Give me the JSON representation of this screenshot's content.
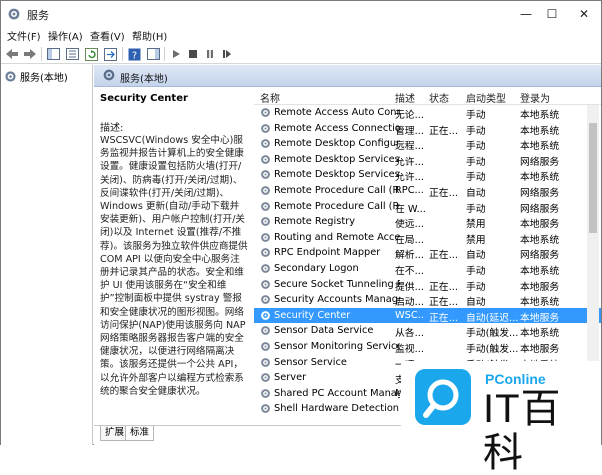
{
  "window": {
    "title": "服务",
    "minimize": "—",
    "maximize": "☐",
    "close": "✕"
  },
  "menu": [
    "文件(F)",
    "操作(A)",
    "查看(V)",
    "帮助(H)"
  ],
  "tree": {
    "root_label": "服务(本地)"
  },
  "content_header": "服务(本地)",
  "description": {
    "service_title": "Security Center",
    "label": "描述:",
    "text": "WSCSVC(Windows 安全中心)服务监视并报告计算机上的安全健康设置。健康设置包括防火墙(打开/关闭)、防病毒(打开/关闭/过期)、反间谍软件(打开/关闭/过期)、Windows 更新(自动/手动下载并安装更新)、用户帐户控制(打开/关闭)以及 Internet 设置(推荐/不推荐)。该服务为独立软件供应商提供 COM API 以便向安全中心服务注册并记录其产品的状态。安全和维护 UI 使用该服务在“安全和维护”控制面板中提供 systray 警报和安全健康状况的图形视图。网络访问保护(NAP)使用该服务向 NAP 网络策略服务器报告客户端的安全健康状况，以便进行网络隔离决策。该服务还提供一个公共 API，以允许外部客户以编程方式检索系统的聚合安全健康状况。"
  },
  "columns": {
    "name": "名称",
    "desc": "描述",
    "status": "状态",
    "startup": "启动类型",
    "logon": "登录为"
  },
  "services": [
    {
      "name": "Remote Access Auto Conn...",
      "desc": "无论...",
      "status": "",
      "startup": "手动",
      "logon": "本地系统"
    },
    {
      "name": "Remote Access Connectio...",
      "desc": "管理...",
      "status": "正在...",
      "startup": "手动",
      "logon": "本地系统"
    },
    {
      "name": "Remote Desktop Configur...",
      "desc": "远程...",
      "status": "",
      "startup": "手动",
      "logon": "本地系统"
    },
    {
      "name": "Remote Desktop Services",
      "desc": "允许...",
      "status": "",
      "startup": "手动",
      "logon": "网络服务"
    },
    {
      "name": "Remote Desktop Services ...",
      "desc": "允许...",
      "status": "",
      "startup": "手动",
      "logon": "本地系统"
    },
    {
      "name": "Remote Procedure Call (R...",
      "desc": "RPC...",
      "status": "正在...",
      "startup": "自动",
      "logon": "网络服务"
    },
    {
      "name": "Remote Procedure Call (R...",
      "desc": "在 W...",
      "status": "",
      "startup": "手动",
      "logon": "网络服务"
    },
    {
      "name": "Remote Registry",
      "desc": "使远...",
      "status": "",
      "startup": "禁用",
      "logon": "本地服务"
    },
    {
      "name": "Routing and Remote Access",
      "desc": "在局...",
      "status": "",
      "startup": "禁用",
      "logon": "本地系统"
    },
    {
      "name": "RPC Endpoint Mapper",
      "desc": "解析...",
      "status": "正在...",
      "startup": "自动",
      "logon": "网络服务"
    },
    {
      "name": "Secondary Logon",
      "desc": "在不...",
      "status": "",
      "startup": "手动",
      "logon": "本地系统"
    },
    {
      "name": "Secure Socket Tunneling P...",
      "desc": "提供...",
      "status": "正在...",
      "startup": "手动",
      "logon": "本地服务"
    },
    {
      "name": "Security Accounts Manager",
      "desc": "启动...",
      "status": "正在...",
      "startup": "自动",
      "logon": "本地系统"
    },
    {
      "name": "Security Center",
      "desc": "WSC...",
      "status": "正在...",
      "startup": "自动(延迟...",
      "logon": "本地服务",
      "selected": true
    },
    {
      "name": "Sensor Data Service",
      "desc": "从各...",
      "status": "",
      "startup": "手动(触发...",
      "logon": "本地系统"
    },
    {
      "name": "Sensor Monitoring Service",
      "desc": "监视...",
      "status": "",
      "startup": "手动(触发...",
      "logon": "本地服务"
    },
    {
      "name": "Sensor Service",
      "desc": "一项...",
      "status": "",
      "startup": "手动(触发...",
      "logon": "本地系统"
    },
    {
      "name": "Server",
      "desc": "支",
      "status": "",
      "startup": "",
      "logon": ""
    },
    {
      "name": "Shared PC Account Manager",
      "desc": "M",
      "status": "",
      "startup": "",
      "logon": ""
    },
    {
      "name": "Shell Hardware Detection",
      "desc": "",
      "status": "",
      "startup": "",
      "logon": ""
    }
  ],
  "tabs": [
    "扩展",
    "标准"
  ],
  "watermark": {
    "brand": "IT百科",
    "sub": "PConline"
  },
  "colors": {
    "selection": "#3399ff",
    "header_gradient_top": "#dfe8f6",
    "accent": "#1aa7ec"
  }
}
